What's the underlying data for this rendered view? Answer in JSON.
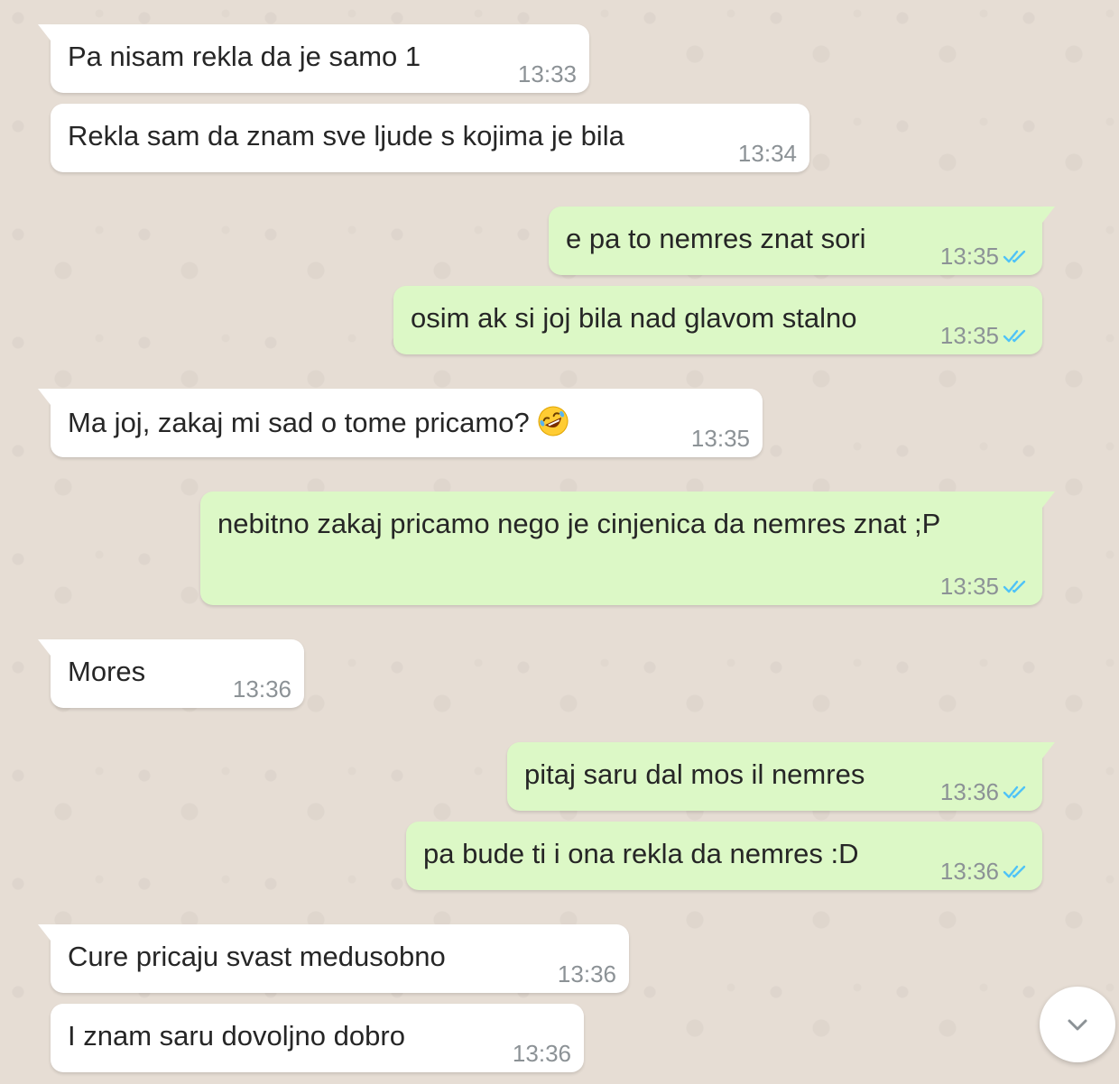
{
  "colors": {
    "background": "#e6ddd4",
    "incoming_bubble": "#ffffff",
    "outgoing_bubble": "#dcf8c6",
    "read_check": "#4fc3f7",
    "time_text": "#8c9296"
  },
  "messages": [
    {
      "direction": "incoming",
      "text": "Pa nisam rekla da je samo 1",
      "time": "13:33"
    },
    {
      "direction": "incoming",
      "text": "Rekla sam da znam sve ljude s kojima je bila",
      "time": "13:34"
    },
    {
      "direction": "outgoing",
      "text": "e pa to nemres znat sori",
      "time": "13:35",
      "status": "read"
    },
    {
      "direction": "outgoing",
      "text": "osim ak si joj bila nad glavom stalno",
      "time": "13:35",
      "status": "read"
    },
    {
      "direction": "incoming",
      "text": "Ma joj, zakaj mi sad o tome pricamo?",
      "emoji": "rolling-on-floor-laughing-emoji",
      "time": "13:35"
    },
    {
      "direction": "outgoing",
      "text": "nebitno zakaj pricamo nego je cinjenica da nemres znat ;P",
      "time": "13:35",
      "status": "read"
    },
    {
      "direction": "incoming",
      "text": "Mores",
      "time": "13:36"
    },
    {
      "direction": "outgoing",
      "text": "pitaj saru dal mos il nemres",
      "time": "13:36",
      "status": "read"
    },
    {
      "direction": "outgoing",
      "text": "pa bude ti i ona rekla da nemres :D",
      "time": "13:36",
      "status": "read"
    },
    {
      "direction": "incoming",
      "text": "Cure pricaju svast medusobno",
      "time": "13:36"
    },
    {
      "direction": "incoming",
      "text": "I znam saru dovoljno dobro",
      "time": "13:36"
    }
  ],
  "scroll_button": {
    "icon": "chevron-down-icon"
  }
}
